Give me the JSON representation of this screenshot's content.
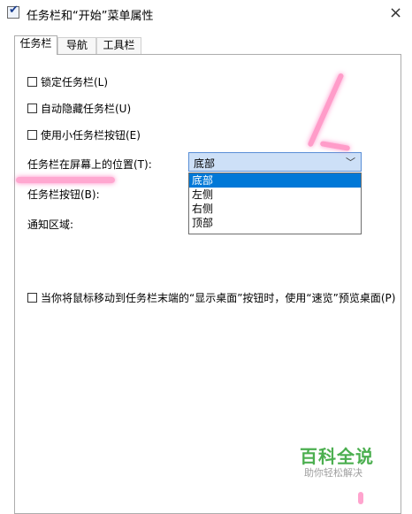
{
  "window": {
    "title": "任务栏和“开始”菜单属性",
    "icon": "checkmark-app-icon",
    "close_glyph": "×"
  },
  "tabs": [
    {
      "label": "任务栏",
      "active": true
    },
    {
      "label": "导航",
      "active": false
    },
    {
      "label": "工具栏",
      "active": false
    }
  ],
  "options": {
    "lock_taskbar": {
      "label": "锁定任务栏(L)",
      "checked": false
    },
    "auto_hide": {
      "label": "自动隐藏任务栏(U)",
      "checked": false
    },
    "small_buttons": {
      "label": "使用小任务栏按钮(E)",
      "checked": false
    },
    "peek_desktop": {
      "label": "当你将鼠标移动到任务栏末端的“显示桌面”按钮时，使用“速览”预览桌面(P)",
      "checked": false
    }
  },
  "position": {
    "label": "任务栏在屏幕上的位置(T):",
    "selected": "底部",
    "options": [
      "底部",
      "左侧",
      "右侧",
      "顶部"
    ]
  },
  "labels": {
    "taskbar_buttons": "任务栏按钮(B):",
    "notification_area": "通知区域:"
  },
  "watermark": {
    "title": "百科全说",
    "subtitle": "助你轻松解决"
  },
  "colors": {
    "selection": "#0078d7",
    "combo_bg": "#cde0f7",
    "annotation": "#ff5fa0",
    "watermark": "#4caf50"
  }
}
